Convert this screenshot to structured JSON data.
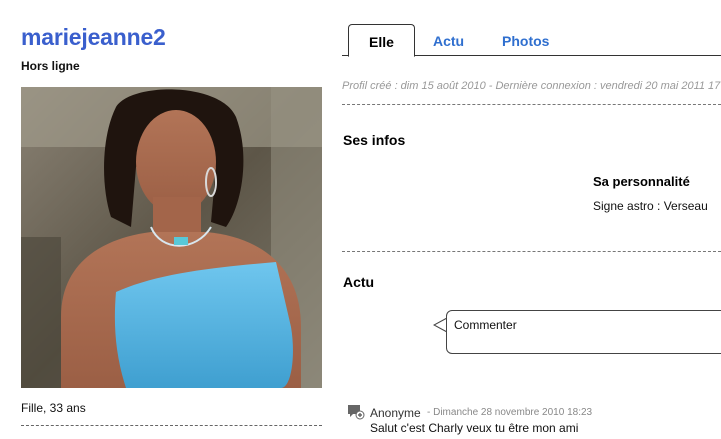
{
  "profile": {
    "username": "mariejeanne2",
    "status": "Hors ligne",
    "caption": "Fille, 33 ans"
  },
  "tabs": [
    {
      "label": "Elle",
      "active": true
    },
    {
      "label": "Actu",
      "active": false
    },
    {
      "label": "Photos",
      "active": false
    }
  ],
  "meta": "Profil créé : dim 15 août 2010 - Dernière connexion : vendredi 20 mai 2011 17",
  "infos": {
    "heading": "Ses infos",
    "personality_title": "Sa personnalité",
    "astro": "Signe astro : Verseau"
  },
  "actu": {
    "heading": "Actu",
    "comment_placeholder": "Commenter",
    "post": {
      "author": "Anonyme",
      "date": "- Dimanche 28 novembre 2010 18:23",
      "text": "Salut c'est Charly veux tu être mon ami"
    }
  },
  "colors": {
    "username": "#3a5fcd",
    "tab_link": "#2f6fcf",
    "top": "#5bb8e6"
  }
}
